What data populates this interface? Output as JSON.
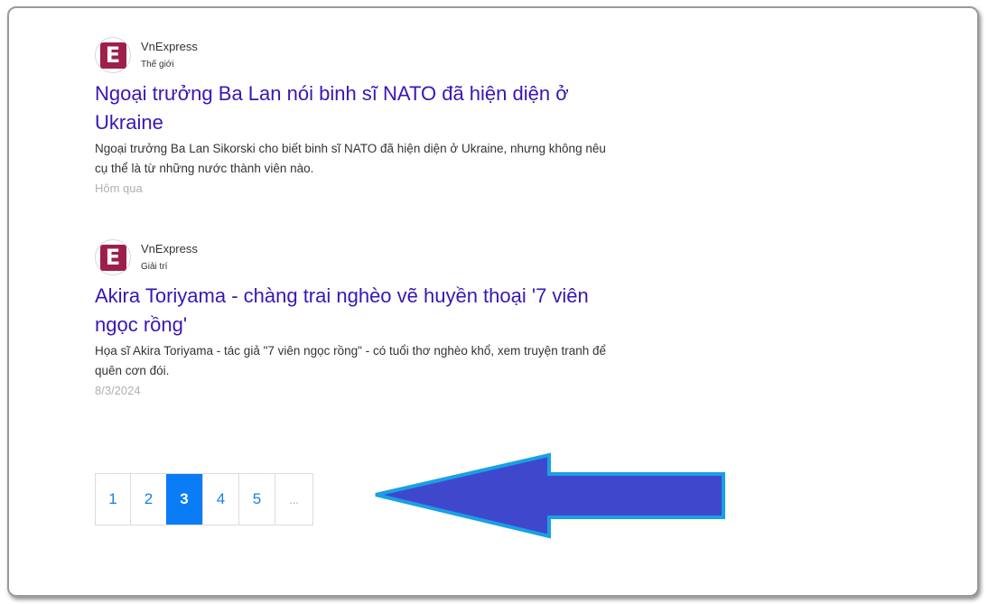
{
  "articles": [
    {
      "source": "VnExpress",
      "category": "Thế giới",
      "logo_letter": "E",
      "title": "Ngoại trưởng Ba Lan nói binh sĩ NATO đã hiện diện ở Ukraine",
      "description": "Ngoại trưởng Ba Lan Sikorski cho biết binh sĩ NATO đã hiện diện ở Ukraine, nhưng không nêu cụ thể là từ những nước thành viên nào.",
      "date": "Hôm qua"
    },
    {
      "source": "VnExpress",
      "category": "Giải trí",
      "logo_letter": "E",
      "title": "Akira Toriyama - chàng trai nghèo vẽ huyền thoại '7 viên ngọc rồng'",
      "description": "Họa sĩ Akira Toriyama - tác giả \"7 viên ngọc rồng\" - có tuổi thơ nghèo khổ, xem truyện tranh để quên cơn đói.",
      "date": "8/3/2024"
    }
  ],
  "pagination": {
    "pages": [
      "1",
      "2",
      "3",
      "4",
      "5"
    ],
    "ellipsis": "...",
    "current": "3"
  },
  "colors": {
    "link": "#3a16b5",
    "accent": "#0a7cf5",
    "logo": "#9e1f4a",
    "arrow_fill": "#3f48cc",
    "arrow_stroke": "#19a0e6"
  }
}
